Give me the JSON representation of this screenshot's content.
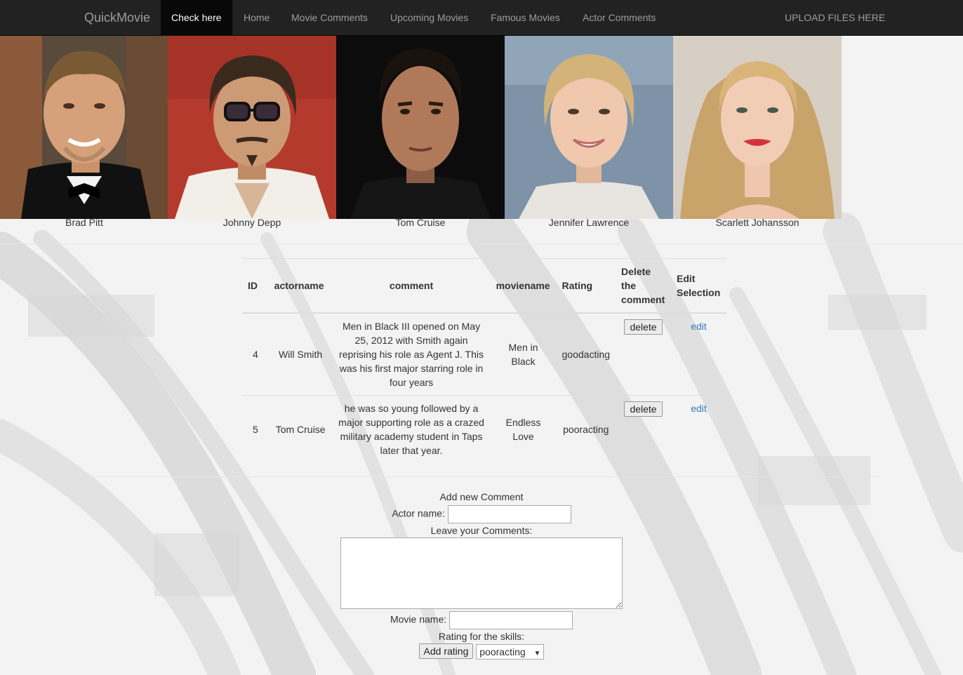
{
  "navbar": {
    "brand": "QuickMovie",
    "items": [
      {
        "label": "Check here"
      },
      {
        "label": "Home"
      },
      {
        "label": "Movie Comments"
      },
      {
        "label": "Upcoming Movies"
      },
      {
        "label": "Famous Movies"
      },
      {
        "label": "Actor Comments"
      }
    ],
    "upload": "UPLOAD FILES HERE"
  },
  "actors": [
    {
      "name": "Brad Pitt"
    },
    {
      "name": "Johnny Depp"
    },
    {
      "name": "Tom Cruise"
    },
    {
      "name": "Jennifer Lawrence"
    },
    {
      "name": "Scarlett Johansson"
    }
  ],
  "table": {
    "headers": {
      "id": "ID",
      "actorname": "actorname",
      "comment": "comment",
      "moviename": "moviename",
      "rating": "Rating",
      "delete": "Delete the comment",
      "edit": "Edit Selection"
    },
    "rows": [
      {
        "id": "4",
        "actorname": "Will Smith",
        "comment": "Men in Black III opened on May 25, 2012 with Smith again reprising his role as Agent J. This was his first major starring role in four years",
        "moviename": "Men in Black",
        "rating": "goodacting",
        "delete_label": "delete",
        "edit_label": "edit"
      },
      {
        "id": "5",
        "actorname": "Tom Cruise",
        "comment": "he was so young followed by a major supporting role as a crazed military academy student in Taps later that year.",
        "moviename": "Endless Love",
        "rating": "pooracting",
        "delete_label": "delete",
        "edit_label": "edit"
      }
    ]
  },
  "form": {
    "title": "Add new Comment",
    "actor_label": "Actor name:",
    "actor_value": "",
    "comments_label": "Leave your Comments:",
    "comments_value": "",
    "movie_label": "Movie name:",
    "movie_value": "",
    "rating_label": "Rating for the skills:",
    "add_button": "Add rating",
    "rating_selected": "pooracting"
  }
}
